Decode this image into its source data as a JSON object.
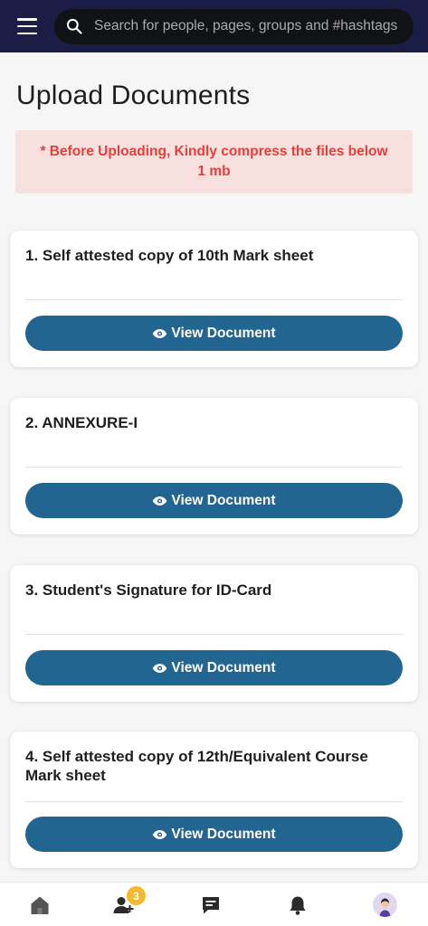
{
  "header": {
    "search_placeholder": "Search for people, pages, groups and #hashtags"
  },
  "page": {
    "title": "Upload Documents",
    "notice": "* Before Uploading, Kindly compress the files below 1 mb"
  },
  "documents": [
    {
      "title": "1. Self attested copy of 10th Mark sheet",
      "button_label": "View Document"
    },
    {
      "title": "2. ANNEXURE-I",
      "button_label": "View Document"
    },
    {
      "title": "3. Student's Signature for ID-Card",
      "button_label": "View Document"
    },
    {
      "title": "4. Self attested copy of 12th/Equivalent Course Mark sheet",
      "button_label": "View Document"
    }
  ],
  "bottom_nav": {
    "items": [
      "home-icon",
      "friend-requests-icon",
      "messages-icon",
      "notifications-icon",
      "profile-avatar"
    ],
    "friend_requests_badge": "3"
  },
  "colors": {
    "header_bg": "#1b1d46",
    "button_bg": "#236591",
    "notice_bg": "#f8e0df",
    "notice_text": "#e5403a",
    "badge": "#f5b92f"
  }
}
